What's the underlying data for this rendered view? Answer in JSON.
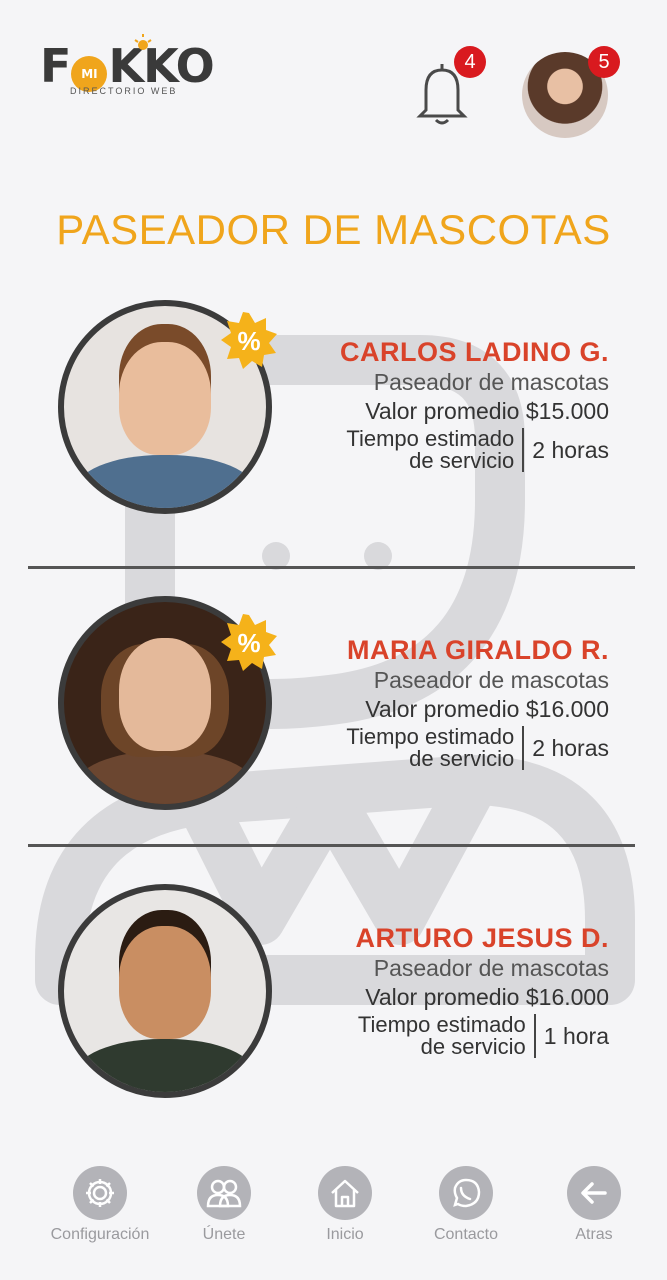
{
  "header": {
    "logo_text": "FOKKO",
    "logo_mark": "MI",
    "logo_subtitle": "DIRECTORIO WEB",
    "notifications_count": "4",
    "profile_badge_count": "5",
    "bell_icon": "bell-icon",
    "avatar_icon": "user-avatar"
  },
  "page": {
    "title": "PASEADOR DE MASCOTAS"
  },
  "providers": [
    {
      "name": "CARLOS LADINO G.",
      "role": "Paseador de mascotas",
      "price": "Valor promedio $15.000",
      "time_label_1": "Tiempo estimado",
      "time_label_2": "de servicio",
      "time_value": "2 horas",
      "promo": "%"
    },
    {
      "name": "MARIA GIRALDO R.",
      "role": "Paseador de mascotas",
      "price": "Valor promedio $16.000",
      "time_label_1": "Tiempo estimado",
      "time_label_2": "de servicio",
      "time_value": "2 horas",
      "promo": "%"
    },
    {
      "name": "ARTURO JESUS D.",
      "role": "Paseador de mascotas",
      "price": "Valor promedio $16.000",
      "time_label_1": "Tiempo estimado",
      "time_label_2": "de servicio",
      "time_value": "1 hora"
    }
  ],
  "nav": [
    {
      "label": "Configuración",
      "icon": "gear-icon"
    },
    {
      "label": "Únete",
      "icon": "users-icon"
    },
    {
      "label": "Inicio",
      "icon": "home-icon"
    },
    {
      "label": "Contacto",
      "icon": "whatsapp-icon"
    },
    {
      "label": "Atras",
      "icon": "arrow-left-icon"
    }
  ],
  "colors": {
    "accent": "#f0a51c",
    "name_red": "#d9432a",
    "badge_red": "#d91a1f",
    "background": "#f5f5f7",
    "nav_gray": "#b3b3b8"
  }
}
